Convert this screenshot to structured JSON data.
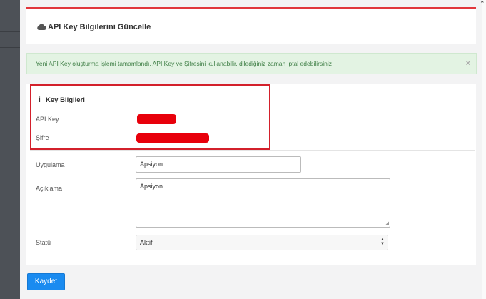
{
  "page": {
    "title": "API Key Bilgilerini Güncelle",
    "header_icon": "cloud-icon"
  },
  "alert": {
    "message": "Yeni API Key oluşturma işlemi tamamlandı, API Key ve Şifresini kullanabilir, dilediğiniz zaman iptal edebilirsiniz",
    "close_symbol": "×"
  },
  "key_info": {
    "icon": "info-icon",
    "icon_glyph": "i",
    "title": "Key Bilgileri",
    "api_key_label": "API Key",
    "password_label": "Şifre",
    "redaction_color": "#e8000b"
  },
  "form": {
    "application_label": "Uygulama",
    "application_value": "Apsiyon",
    "description_label": "Açıklama",
    "description_value": "Apsiyon",
    "status_label": "Statü",
    "status_value": "Aktif"
  },
  "actions": {
    "save_label": "Kaydet"
  },
  "colors": {
    "accent_red": "#e1373c",
    "primary_button": "#1a8bf0",
    "alert_bg": "#e3f3e3",
    "alert_text": "#3f7f46"
  }
}
